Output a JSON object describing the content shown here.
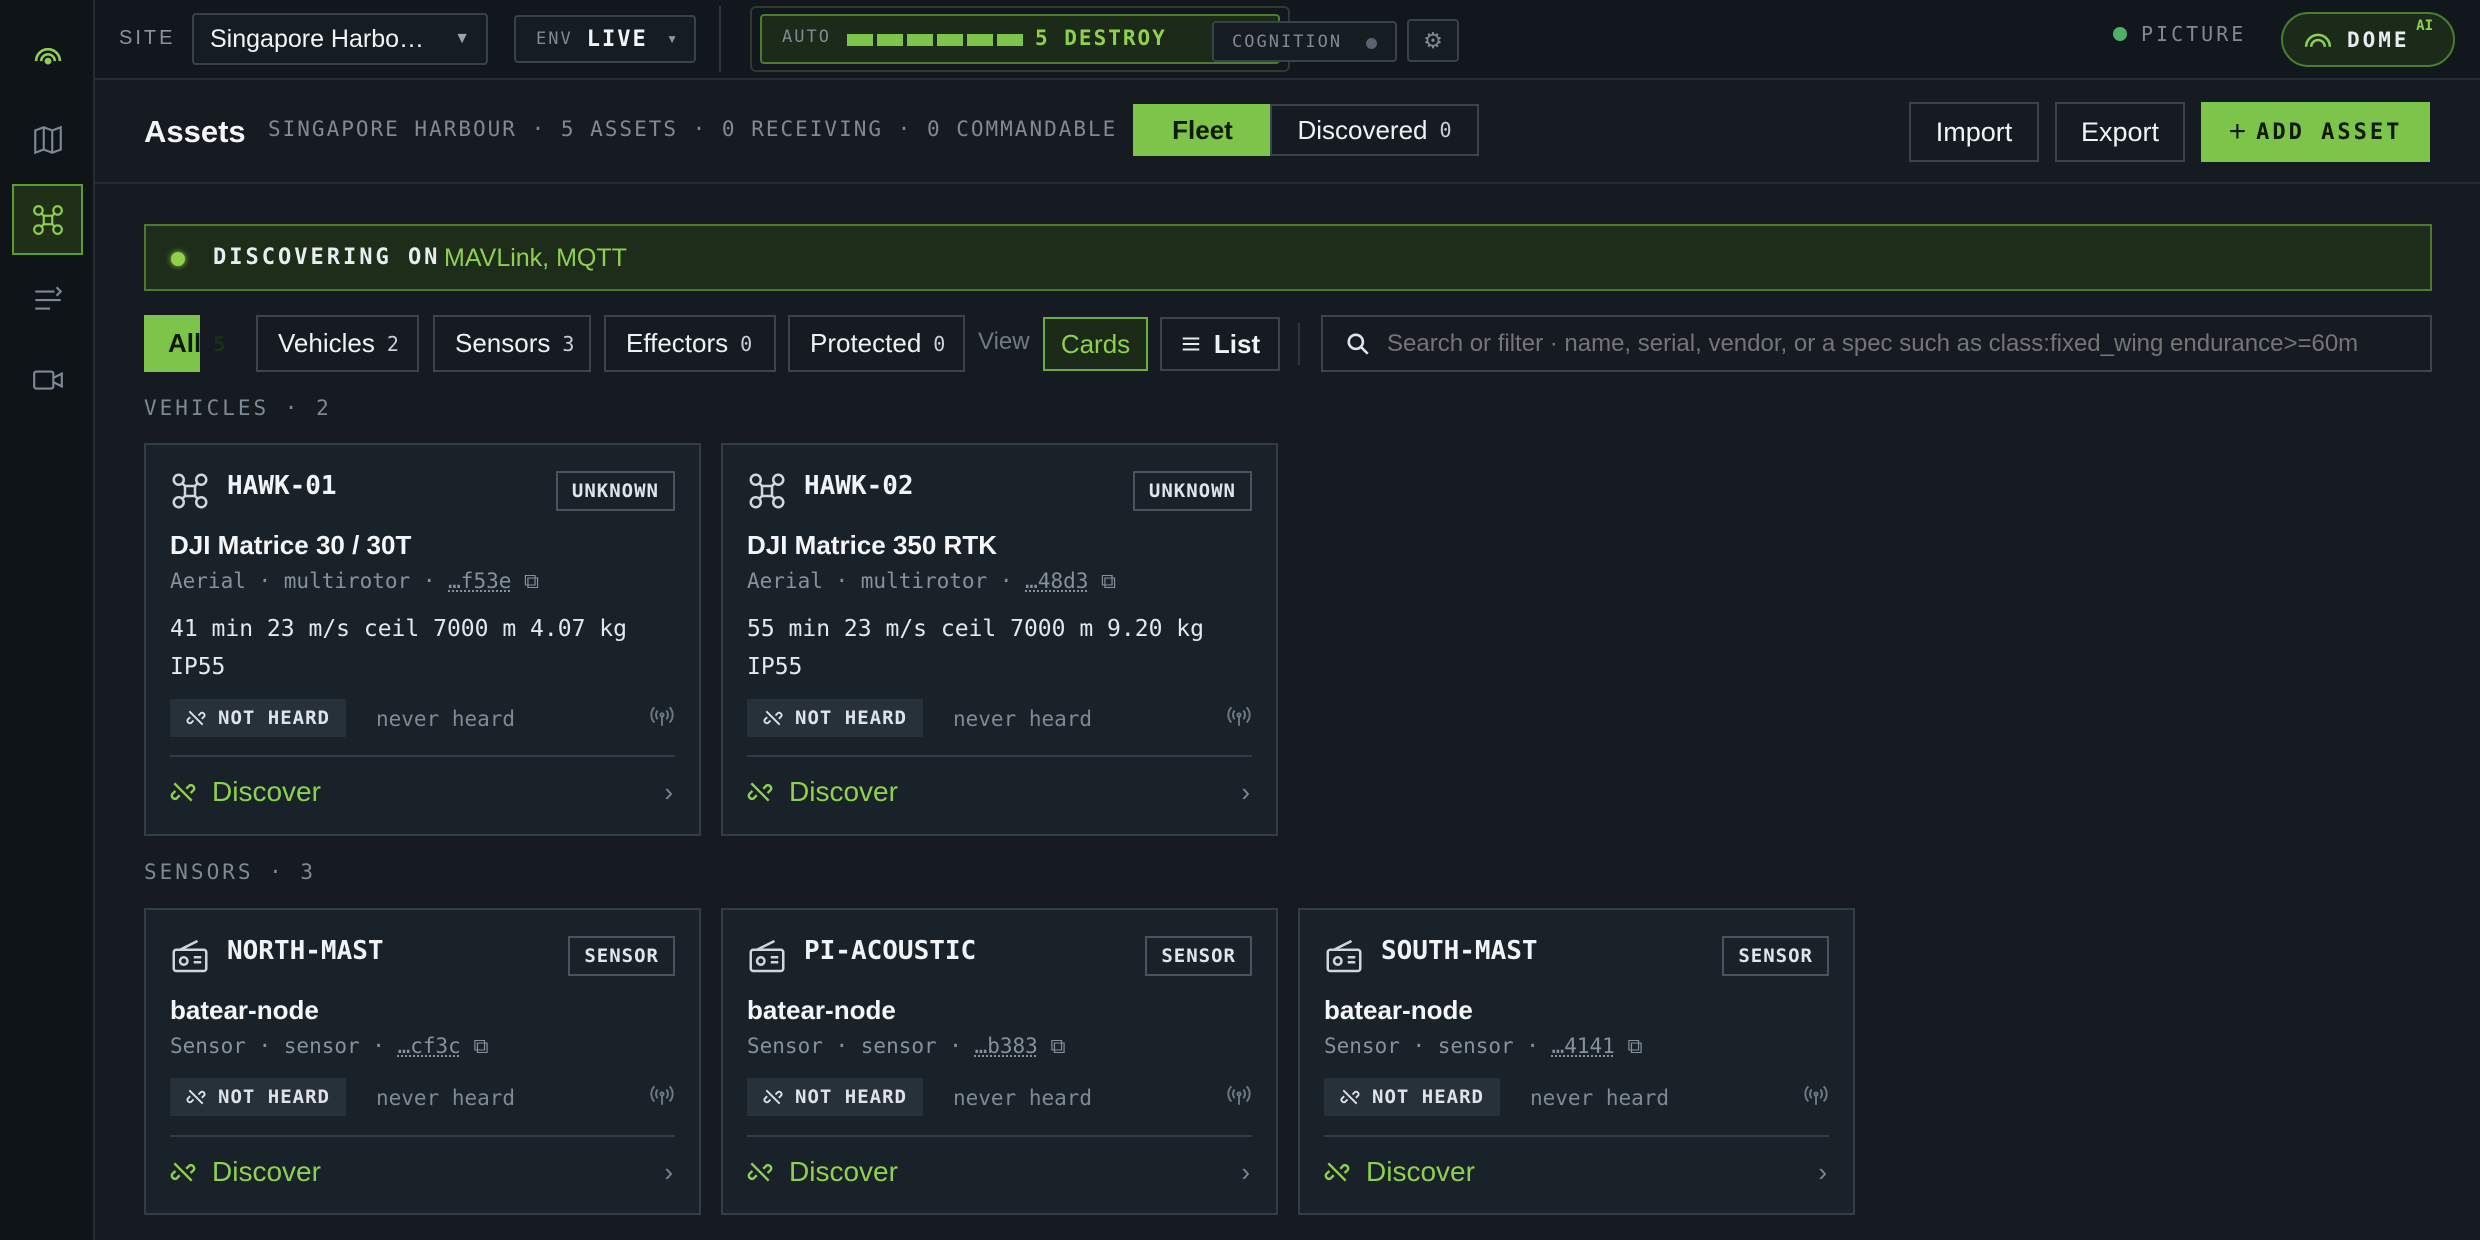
{
  "topbar": {
    "site_label": "SITE",
    "site_value": "Singapore Harbo…",
    "env_label": "ENV",
    "env_value": "LIVE",
    "auto_label": "AUTO",
    "auto_state": "5 DESTROY",
    "auto_level": 5,
    "cognition_label": "COGNITION",
    "picture_label": "PICTURE",
    "dome_label": "DOME",
    "dome_sup": "AI"
  },
  "rail": {
    "items": [
      "map-icon",
      "drone-icon",
      "tasks-icon",
      "video-icon"
    ]
  },
  "assets": {
    "title": "Assets",
    "subtitle": "SINGAPORE HARBOUR · 5 ASSETS · 0 RECEIVING · 0 COMMANDABLE",
    "fleet_tab": "Fleet",
    "discovered_tab": "Discovered",
    "discovered_count": "0",
    "import": "Import",
    "export": "Export",
    "add": "ADD ASSET"
  },
  "banner": {
    "label": "DISCOVERING ON",
    "protocols": "MAVLink, MQTT"
  },
  "filters": {
    "chips": [
      {
        "label": "All",
        "count": "5"
      },
      {
        "label": "Vehicles",
        "count": "2"
      },
      {
        "label": "Sensors",
        "count": "3"
      },
      {
        "label": "Effectors",
        "count": "0"
      },
      {
        "label": "Protected",
        "count": "0"
      }
    ],
    "view_label": "View",
    "cards": "Cards",
    "list": "List",
    "search_placeholder": "Search or filter · name, serial, vendor, or a spec such as class:fixed_wing endurance>=60m"
  },
  "sections": {
    "vehicles": "VEHICLES · 2",
    "sensors": "SENSORS · 3"
  },
  "vehicles": [
    {
      "name": "HAWK-01",
      "badge": "UNKNOWN",
      "model": "DJI Matrice 30 / 30T",
      "meta_prefix": "Aerial · multirotor · ",
      "serial": "…f53e",
      "specs": "41 min 23 m/s ceil 7000 m 4.07 kg IP55",
      "status": "NOT HEARD",
      "heard": "never heard",
      "action": "Discover"
    },
    {
      "name": "HAWK-02",
      "badge": "UNKNOWN",
      "model": "DJI Matrice 350 RTK",
      "meta_prefix": "Aerial · multirotor · ",
      "serial": "…48d3",
      "specs": "55 min 23 m/s ceil 7000 m 9.20 kg IP55",
      "status": "NOT HEARD",
      "heard": "never heard",
      "action": "Discover"
    }
  ],
  "sensors": [
    {
      "name": "NORTH-MAST",
      "badge": "SENSOR",
      "model": "batear-node",
      "meta_prefix": "Sensor · sensor · ",
      "serial": "…cf3c",
      "status": "NOT HEARD",
      "heard": "never heard",
      "action": "Discover"
    },
    {
      "name": "PI-ACOUSTIC",
      "badge": "SENSOR",
      "model": "batear-node",
      "meta_prefix": "Sensor · sensor · ",
      "serial": "…b383",
      "status": "NOT HEARD",
      "heard": "never heard",
      "action": "Discover"
    },
    {
      "name": "SOUTH-MAST",
      "badge": "SENSOR",
      "model": "batear-node",
      "meta_prefix": "Sensor · sensor · ",
      "serial": "…4141",
      "status": "NOT HEARD",
      "heard": "never heard",
      "action": "Discover"
    }
  ]
}
